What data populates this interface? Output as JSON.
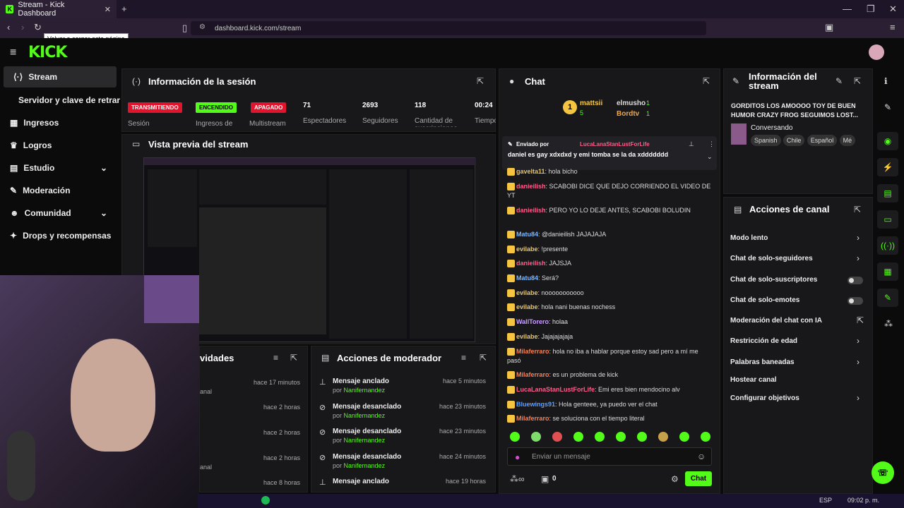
{
  "browser": {
    "tab_title": "Stream - Kick Dashboard",
    "url": "dashboard.kick.com/stream",
    "tooltip": "Volver a cargar esta página"
  },
  "logo": "KICK",
  "sidebar": {
    "items": [
      {
        "label": "Stream"
      },
      {
        "label": "Servidor y clave de retransmisión"
      },
      {
        "label": "Ingresos"
      },
      {
        "label": "Logros"
      },
      {
        "label": "Estudio"
      },
      {
        "label": "Moderación"
      },
      {
        "label": "Comunidad"
      },
      {
        "label": "Drops y recompensas"
      }
    ]
  },
  "session": {
    "title": "Información de la sesión",
    "badges": [
      {
        "text": "TRANSMITIENDO",
        "label": "Sesión"
      },
      {
        "text": "ENCENDIDO",
        "label": "Ingresos de"
      },
      {
        "text": "APAGADO",
        "label": "Multistream"
      }
    ],
    "stats": [
      {
        "value": "71",
        "label": "Espectadores"
      },
      {
        "value": "2693",
        "label": "Seguidores"
      },
      {
        "value": "118",
        "label": "Cantidad de suscripciones"
      },
      {
        "value": "00:24",
        "label": "Tiempo"
      }
    ]
  },
  "preview": {
    "title": "Vista previa del stream"
  },
  "activities": {
    "title": "vidades",
    "rows": [
      {
        "time": "hace 17 minutos",
        "text": ""
      },
      {
        "time": "hace 2 horas",
        "text": "anal"
      },
      {
        "time": "hace 2 horas",
        "text": ""
      },
      {
        "time": "hace 2 horas",
        "text": "anal"
      },
      {
        "time": "hace 8 horas",
        "text": ""
      }
    ]
  },
  "mod_actions": {
    "title": "Acciones de moderador",
    "rows": [
      {
        "title": "Mensaje anclado",
        "by": "Nanifernandez",
        "time": "hace 5 minutos"
      },
      {
        "title": "Mensaje desanclado",
        "by": "Nanifernandez",
        "time": "hace 23 minutos"
      },
      {
        "title": "Mensaje desanclado",
        "by": "Nanifernandez",
        "time": "hace 23 minutos"
      },
      {
        "title": "Mensaje desanclado",
        "by": "Nanifernandez",
        "time": "hace 24 minutos"
      },
      {
        "title": "Mensaje anclado",
        "by": "",
        "time": "hace 19 horas"
      }
    ],
    "by_prefix": "por"
  },
  "chat": {
    "title": "Chat",
    "top": [
      {
        "name": "mattsii",
        "count": "5"
      },
      {
        "name": "elmusho",
        "count": "1"
      },
      {
        "name": "Bordtv",
        "count": "1"
      }
    ],
    "pinned": {
      "label": "Enviado por",
      "user": "LucaLanaStanLustForLife",
      "text": "daniel es gay xdxdxd y emi tomba se la da xddddddd"
    },
    "messages": [
      {
        "user": "gavelta11",
        "text": "hola bicho",
        "color": "#e8c66b"
      },
      {
        "user": "danieilish",
        "text": "SCABOBI DICE QUE DEJO CORRIENDO EL VIDEO DE YT",
        "color": "#ff5c8a"
      },
      {
        "user": "danieilish",
        "text": "PERO YO LO DEJE ANTES, SCABOBI BOLUDIN",
        "color": "#ff5c8a"
      },
      {
        "user": "Matu84",
        "text": "@danieilish JAJAJAJA",
        "color": "#7fb8ff"
      },
      {
        "user": "evilabe",
        "text": "!presente",
        "color": "#e8c66b"
      },
      {
        "user": "danieilish",
        "text": "JAJSJA",
        "color": "#ff5c8a"
      },
      {
        "user": "Matu84",
        "text": "Será?",
        "color": "#7fb8ff"
      },
      {
        "user": "evilabe",
        "text": "nooooooooooo",
        "color": "#e8c66b"
      },
      {
        "user": "evilabe",
        "text": "hola nani buenas nochess",
        "color": "#e8c66b"
      },
      {
        "user": "WallTorero",
        "text": "holaa",
        "color": "#c9a0ff"
      },
      {
        "user": "evilabe",
        "text": "Jajajajajaja",
        "color": "#e8c66b"
      },
      {
        "user": "Milaferraro",
        "text": "hola no iba a hablar porque estoy sad pero a mí me pasó",
        "color": "#ff7f50"
      },
      {
        "user": "Milaferraro",
        "text": "es un problema de kick",
        "color": "#ff7f50"
      },
      {
        "user": "LucaLanaStanLustForLife",
        "text": "Emi eres bien mendocino alv",
        "color": "#ff5c8a"
      },
      {
        "user": "Bluewings91",
        "text": "Hola genteee, ya puedo ver el chat",
        "color": "#5aa0ff"
      },
      {
        "user": "Milaferraro",
        "text": "se soluciona con el tiempo literal",
        "color": "#ff7f50"
      }
    ],
    "input_placeholder": "Enviar un mensaje",
    "points": "0",
    "send_label": "Chat"
  },
  "stream_info": {
    "title": "Información del stream",
    "stream_title": "GORDITOS LOS AMOOOO TOY DE BUEN HUMOR CRAZY FROG SEGUIMOS LOST...",
    "category": "Conversando",
    "tags": [
      "Spanish",
      "Chile",
      "Español",
      "Mé"
    ]
  },
  "channel_actions": {
    "title": "Acciones de canal",
    "items": [
      {
        "label": "Modo lento",
        "ctrl": "chev"
      },
      {
        "label": "Chat de solo-seguidores",
        "ctrl": "chev"
      },
      {
        "label": "Chat de solo-suscriptores",
        "ctrl": "toggle"
      },
      {
        "label": "Chat de solo-emotes",
        "ctrl": "toggle"
      },
      {
        "label": "Moderación del chat con IA",
        "ctrl": "ext"
      },
      {
        "label": "Restricción de edad",
        "ctrl": "chev"
      },
      {
        "label": "Palabras baneadas",
        "ctrl": "chev"
      },
      {
        "label": "Hostear canal",
        "ctrl": ""
      },
      {
        "label": "Configurar objetivos",
        "ctrl": "chev"
      }
    ]
  },
  "taskbar": {
    "lang": "ESP",
    "time": "09:02 p. m."
  },
  "colors": {
    "accent": "#53fc18",
    "transmitiendo": "#e0142c",
    "apagado": "#e0142c"
  }
}
